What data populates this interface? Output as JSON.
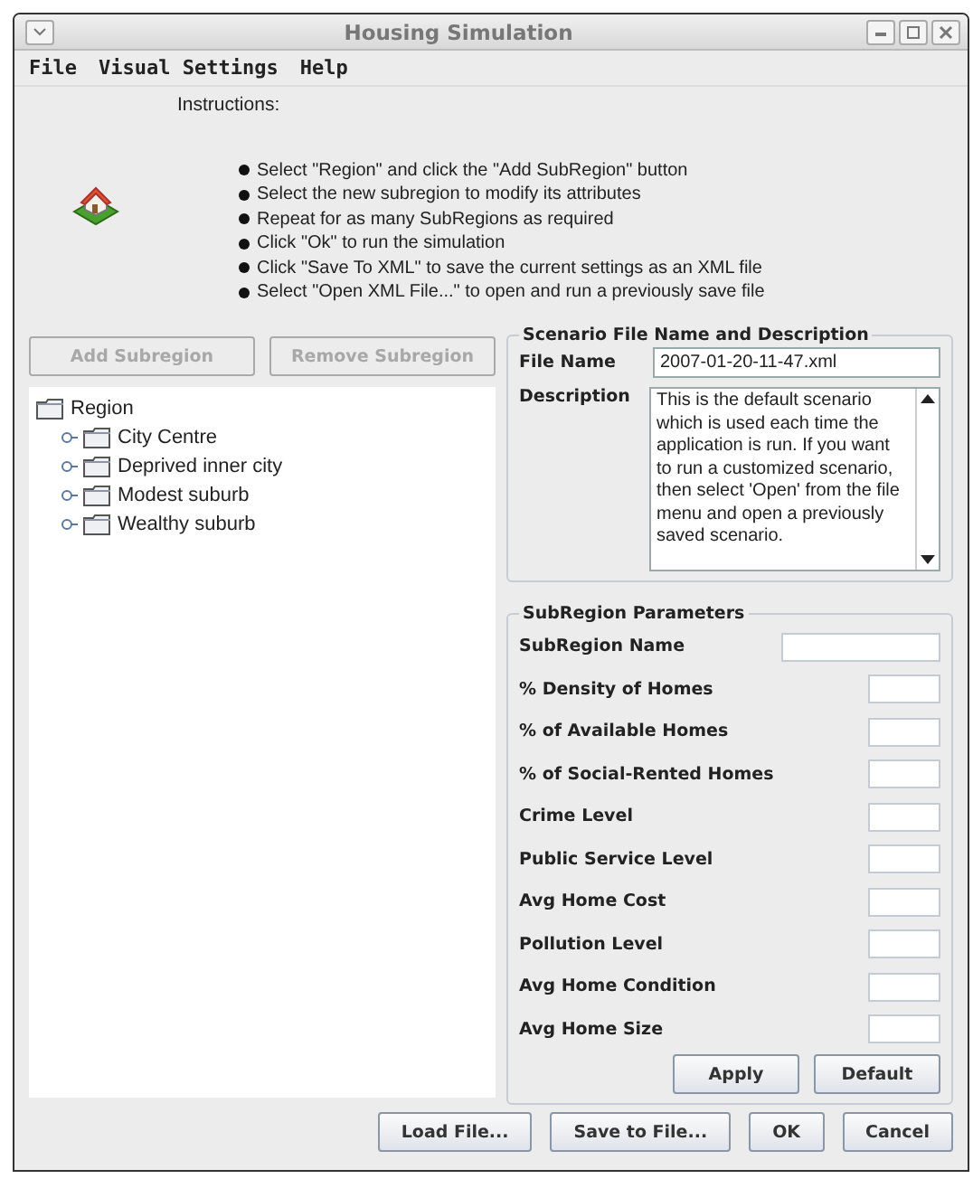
{
  "window": {
    "title": "Housing Simulation"
  },
  "menu": [
    "File",
    "Visual Settings",
    "Help"
  ],
  "instructions": {
    "heading": "Instructions:",
    "items": [
      "Select \"Region\" and click the \"Add SubRegion\" button",
      "Select the new subregion to modify its attributes",
      "Repeat for as many SubRegions as required",
      "Click \"Ok\" to run the simulation",
      "Click \"Save To XML\" to save the current settings as an XML file",
      "Select \"Open XML File...\" to open and run a previously save file"
    ]
  },
  "tree_buttons": [
    {
      "label": "Add Subregion",
      "disabled": true
    },
    {
      "label": "Remove Subregion",
      "disabled": true
    }
  ],
  "tree": {
    "label": "Region",
    "children": [
      {
        "label": "City Centre",
        "expanded": false
      },
      {
        "label": "Deprived inner city",
        "expanded": false
      },
      {
        "label": "Modest suburb",
        "expanded": false
      },
      {
        "label": "Wealthy suburb",
        "expanded": false
      }
    ]
  },
  "scenario": {
    "title": "Scenario File Name and Description",
    "file_name_label": "File Name",
    "file_name": "2007-01-20-11-47.xml",
    "description_label": "Description",
    "description": "This is the default scenario which is used each time the application is run. If you want to run a customized scenario, then select 'Open' from the file menu and open a previously saved scenario."
  },
  "parameters": {
    "title": "SubRegion Parameters",
    "fields": [
      {
        "label": "SubRegion Name",
        "kind": "wide"
      },
      {
        "label": "% Density of Homes",
        "kind": "narrow"
      },
      {
        "label": "% of Available Homes",
        "kind": "narrow"
      },
      {
        "label": "% of Social-Rented Homes",
        "kind": "narrow"
      },
      {
        "label": "Crime Level",
        "kind": "narrow"
      },
      {
        "label": "Public Service Level",
        "kind": "narrow"
      },
      {
        "label": "Avg Home Cost",
        "kind": "narrow"
      },
      {
        "label": "Pollution Level",
        "kind": "narrow"
      },
      {
        "label": "Avg Home Condition",
        "kind": "narrow"
      },
      {
        "label": "Avg Home Size",
        "kind": "narrow"
      }
    ],
    "buttons": [
      "Apply",
      "Default"
    ]
  },
  "buttons": [
    "Load File...",
    "Save to File...",
    "OK",
    "Cancel"
  ]
}
